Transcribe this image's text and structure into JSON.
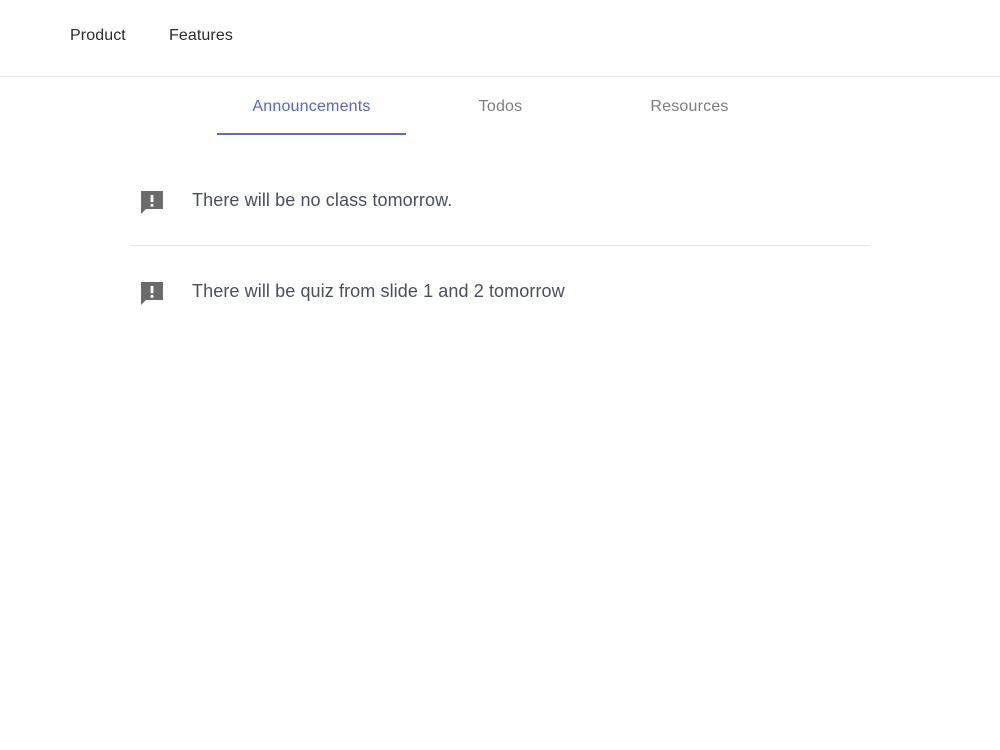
{
  "nav": {
    "links": [
      {
        "label": "Product"
      },
      {
        "label": "Features"
      }
    ]
  },
  "tabs": [
    {
      "label": "Announcements",
      "active": true
    },
    {
      "label": "Todos",
      "active": false
    },
    {
      "label": "Resources",
      "active": false
    }
  ],
  "announcements": [
    {
      "icon": "feedback-icon",
      "text": "There will be no class tomorrow."
    },
    {
      "icon": "feedback-icon",
      "text": "There will be quiz from slide 1 and 2 tomorrow"
    }
  ],
  "colors": {
    "accent": "#5f6bc9",
    "tab_inactive": "#7d7d7d",
    "icon": "#6b6b6b",
    "text": "#4a4f5e"
  }
}
